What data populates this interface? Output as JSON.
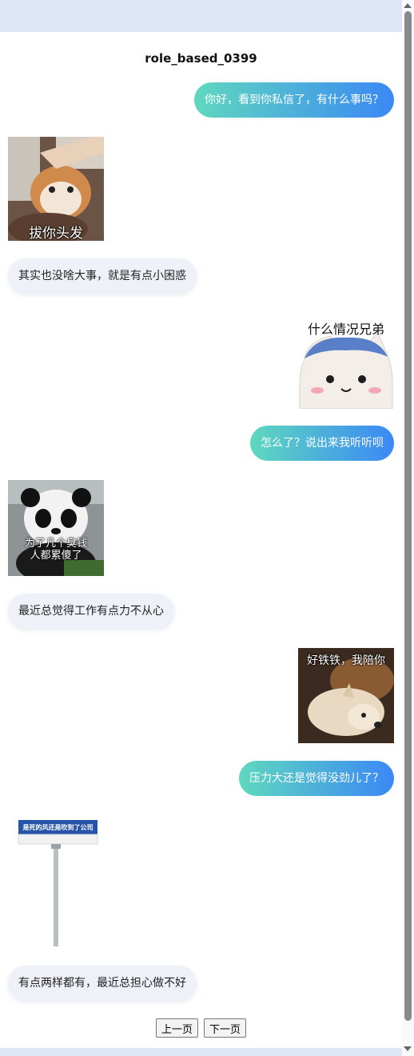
{
  "title": "role_based_0399",
  "messages": [
    {
      "side": "right",
      "type": "text",
      "text": "你好，看到你私信了，有什么事吗？"
    },
    {
      "side": "left",
      "type": "sticker",
      "caption": "拔你头发",
      "icon": "cat-sticker"
    },
    {
      "side": "left",
      "type": "text",
      "text": "其实也没啥大事，就是有点小困惑"
    },
    {
      "side": "right",
      "type": "sticker",
      "caption": "什么情况兄弟",
      "icon": "cartoon-face-sticker"
    },
    {
      "side": "right",
      "type": "text",
      "text": "怎么了？说出来我听听呗"
    },
    {
      "side": "left",
      "type": "sticker",
      "caption": "为了几个臭钱\n人都累傻了",
      "icon": "panda-sticker"
    },
    {
      "side": "left",
      "type": "text",
      "text": "最近总觉得工作有点力不从心"
    },
    {
      "side": "right",
      "type": "sticker",
      "caption": "好铁铁，我陪你",
      "icon": "dogs-sticker"
    },
    {
      "side": "right",
      "type": "text",
      "text": "压力大还是觉得没劲儿了？"
    },
    {
      "side": "left",
      "type": "sticker",
      "caption": "是死的风还是吹到了公司",
      "icon": "sign-pole-sticker"
    },
    {
      "side": "left",
      "type": "text",
      "text": "有点两样都有，最近总担心做不好"
    }
  ],
  "pager": {
    "prev": "上一页",
    "next": "下一页"
  },
  "colors": {
    "gradient_start": "#5fd8bf",
    "gradient_end": "#3b88f5",
    "left_bubble": "#eef2f8"
  }
}
